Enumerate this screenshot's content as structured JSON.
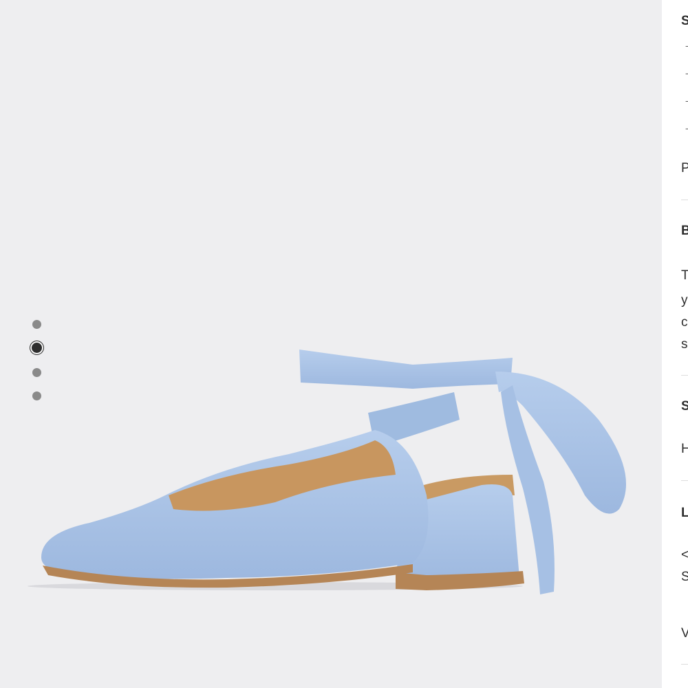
{
  "gallery": {
    "image_alt": "Light blue faux-suede slingback block heel shoe with ankle tie",
    "thumbnails": [
      {
        "state": "inactive"
      },
      {
        "state": "active"
      },
      {
        "state": "inactive"
      },
      {
        "state": "inactive"
      }
    ]
  },
  "details": {
    "section1_heading": "S",
    "bullets": [
      "-",
      "-",
      "-",
      "-"
    ],
    "para1": "P",
    "section2_heading": "B",
    "para2_lines": [
      "T",
      "y",
      "c",
      "s"
    ],
    "section3_heading": "S",
    "para3": "H",
    "section4_heading": "L",
    "para4_lines": [
      "<",
      "S"
    ],
    "para5": "V"
  },
  "colors": {
    "background": "#eeeef0",
    "shoe": "#a9c3e6",
    "active_dot": "#2d2d2d",
    "inactive_dot": "#8a8a8a"
  }
}
